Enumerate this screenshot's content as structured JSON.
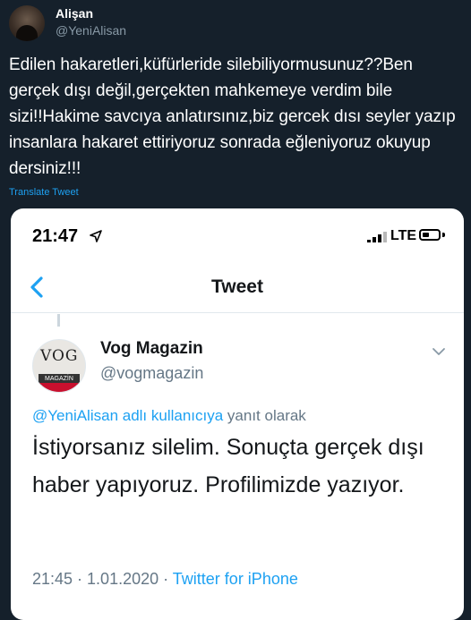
{
  "author": {
    "name": "Alişan",
    "handle": "@YeniAlisan"
  },
  "tweet": {
    "text": "Edilen hakaretleri,küfürleride silebiliyormusunuz??Ben gerçek dışı değil,gerçekten mahkemeye verdim bile sizi!!Hakime savcıya anlatırsınız,biz gercek dısı seyler yazıp insanlara hakaret ettiriyoruz sonrada eğleniyoruz okuyup dersiniz!!!",
    "translate_label": "Translate Tweet"
  },
  "screenshot": {
    "status": {
      "time": "21:47",
      "network": "LTE"
    },
    "nav": {
      "title": "Tweet"
    },
    "quoted": {
      "name": "Vog Magazin",
      "handle": "@vogmagazin",
      "avatar_logo": "VOG",
      "avatar_subtitle": "MAGAZİN",
      "reply_mention": "@YeniAlisan adlı kullanıcıya",
      "reply_suffix": " yanıt olarak",
      "text": "İstiyorsanız silelim. Sonuçta gerçek dışı haber yapıyoruz. Profilimizde yazıyor.",
      "time": "21:45",
      "date": "1.01.2020",
      "source": "Twitter for iPhone",
      "separator": " · "
    }
  },
  "colors": {
    "background": "#15202b",
    "link": "#1da1f2",
    "muted": "#8899a6"
  },
  "icons": [
    "location-arrow-icon",
    "signal-bars-icon",
    "battery-icon",
    "back-chevron-icon",
    "chevron-down-icon"
  ]
}
